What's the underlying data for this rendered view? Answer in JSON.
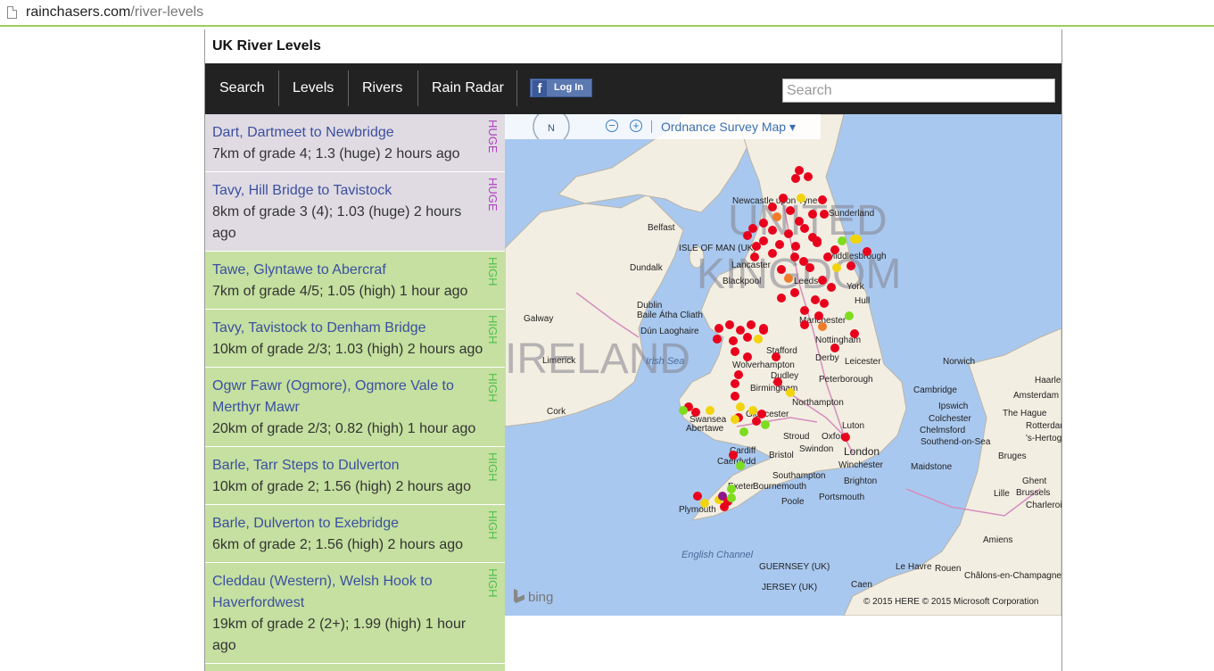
{
  "browser": {
    "url_host": "rainchasers.com",
    "url_path": "/river-levels"
  },
  "site": {
    "title": "UK River Levels"
  },
  "nav": {
    "items": [
      "Search",
      "Levels",
      "Rivers",
      "Rain Radar"
    ],
    "facebook_login": "Log In",
    "search_placeholder": "Search"
  },
  "rivers": [
    {
      "name": "Dart, Dartmeet to Newbridge",
      "detail": "7km of grade 4; 1.3 (huge) 2 hours ago",
      "level": "HUGE"
    },
    {
      "name": "Tavy, Hill Bridge to Tavistock",
      "detail": "8km of grade 3 (4); 1.03 (huge) 2 hours ago",
      "level": "HUGE"
    },
    {
      "name": "Tawe, Glyntawe to Abercraf",
      "detail": "7km of grade 4/5; 1.05 (high) 1 hour ago",
      "level": "HIGH"
    },
    {
      "name": "Tavy, Tavistock to Denham Bridge",
      "detail": "10km of grade 2/3; 1.03 (high) 2 hours ago",
      "level": "HIGH"
    },
    {
      "name": "Ogwr Fawr (Ogmore), Ogmore Vale to Merthyr Mawr",
      "detail": "20km of grade 2/3; 0.82 (high) 1 hour ago",
      "level": "HIGH"
    },
    {
      "name": "Barle, Tarr Steps to Dulverton",
      "detail": "10km of grade 2; 1.56 (high) 2 hours ago",
      "level": "HIGH"
    },
    {
      "name": "Barle, Dulverton to Exebridge",
      "detail": "6km of grade 2; 1.56 (high) 2 hours ago",
      "level": "HIGH"
    },
    {
      "name": "Cleddau (Western), Welsh Hook to Haverfordwest",
      "detail": "19km of grade 2 (2+); 1.99 (high) 1 hour ago",
      "level": "HIGH"
    }
  ],
  "map": {
    "type_label": "Ordnance Survey Map ▾",
    "compass_label": "N",
    "zoom_out": "−",
    "zoom_in": "+",
    "brand": "bing",
    "copyright": "© 2015 HERE    © 2015 Microsoft Corporation",
    "country_labels": [
      "UNITED",
      "KINGDOM",
      "IRELAND"
    ],
    "sea_labels": [
      "Irish Sea",
      "English Channel"
    ],
    "place_labels": [
      "Newcastle upon Tyne",
      "Sunderland",
      "Belfast",
      "ISLE OF MAN (UK)",
      "Dundalk",
      "Lancaster",
      "Blackpool",
      "Leeds",
      "Middlesbrough",
      "York",
      "Hull",
      "Dublin",
      "Baile Átha Cliath",
      "Dún Laoghaire",
      "Galway",
      "Manchester",
      "Nottingham",
      "Stafford",
      "Derby",
      "Leicester",
      "Norwich",
      "Limerick",
      "Wolverhampton",
      "Birmingham",
      "Dudley",
      "Peterborough",
      "Cambridge",
      "Ipswich",
      "Cork",
      "Swansea",
      "Abertawe",
      "Gloucester",
      "Northampton",
      "Luton",
      "Colchester",
      "Chelmsford",
      "Southend-on-Sea",
      "Cardiff",
      "Caerdydd",
      "Bristol",
      "Stroud",
      "Swindon",
      "Oxford",
      "London",
      "Winchester",
      "Maidstone",
      "Southampton",
      "Brighton",
      "Exeter",
      "Bournemouth",
      "Poole",
      "Portsmouth",
      "Plymouth",
      "GUERNSEY (UK)",
      "JERSEY (UK)",
      "Caen",
      "Le Havre",
      "Rouen",
      "Amiens",
      "Lille",
      "Ghent",
      "Brussels",
      "Bruges",
      "Amsterdam",
      "The Hague",
      "Rotterdam",
      "Haarlem",
      "'s-Hertogenbosch",
      "Charleroi",
      "Châlons-en-Champagne"
    ],
    "status_colors": {
      "huge": "#8b1a8b",
      "very_high": "#e8001c",
      "high": "#7ddc1f",
      "medium": "#f2d40c",
      "low": "#f07c2a"
    }
  }
}
